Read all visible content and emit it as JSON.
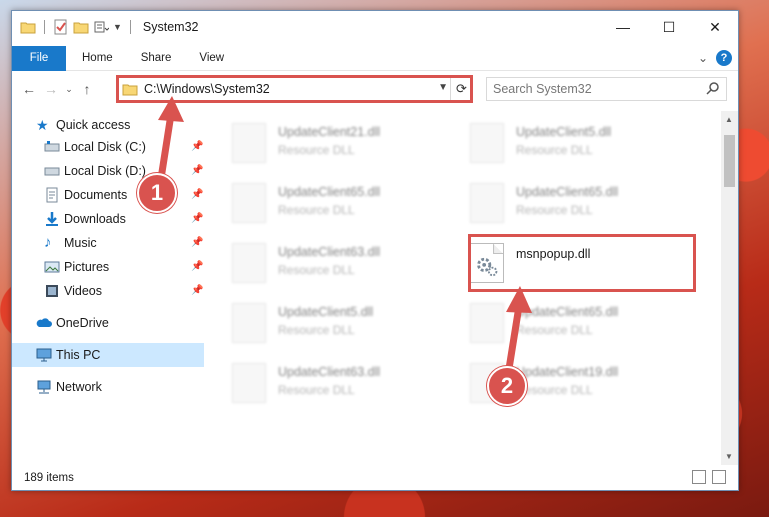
{
  "window": {
    "title": "System32"
  },
  "ribbon": {
    "file": "File",
    "tabs": [
      "Home",
      "Share",
      "View"
    ],
    "help": "?"
  },
  "nav": {
    "path": "C:\\Windows\\System32",
    "search_placeholder": "Search System32"
  },
  "sidebar": {
    "items": [
      {
        "label": "Quick access",
        "icon": "star-icon"
      },
      {
        "label": "Local Disk (C:)",
        "icon": "drive-icon",
        "pinned": true
      },
      {
        "label": "Local Disk (D:)",
        "icon": "drive-icon",
        "pinned": true
      },
      {
        "label": "Documents",
        "icon": "documents-icon",
        "pinned": true
      },
      {
        "label": "Downloads",
        "icon": "download-icon",
        "pinned": true
      },
      {
        "label": "Music",
        "icon": "music-icon",
        "pinned": true
      },
      {
        "label": "Pictures",
        "icon": "pictures-icon",
        "pinned": true
      },
      {
        "label": "Videos",
        "icon": "videos-icon",
        "pinned": true
      },
      {
        "label": "OneDrive",
        "icon": "cloud-icon"
      },
      {
        "label": "This PC",
        "icon": "computer-icon",
        "selected": true
      },
      {
        "label": "Network",
        "icon": "network-icon"
      }
    ]
  },
  "files": [
    {
      "name": "UpdateClient21.dll",
      "type": "Resource DLL"
    },
    {
      "name": "UpdateClient5.dll",
      "type": "Resource DLL"
    },
    {
      "name": "UpdateClient65.dll",
      "type": "Resource DLL"
    },
    {
      "name": "UpdateClient65.dll",
      "type": "Resource DLL"
    },
    {
      "name": "UpdateClient63.dll",
      "type": "Resource DLL"
    },
    {
      "name": "msnpopup.dll",
      "type": ""
    },
    {
      "name": "UpdateClient5.dll",
      "type": "Resource DLL"
    },
    {
      "name": "UpdateClient65.dll",
      "type": "Resource DLL"
    },
    {
      "name": "UpdateClient63.dll",
      "type": "Resource DLL"
    },
    {
      "name": "UpdateClient19.dll",
      "type": "Resource DLL"
    }
  ],
  "status": {
    "items": "189 items"
  },
  "markers": [
    "1",
    "2"
  ],
  "colors": {
    "accent": "#1979ca",
    "highlight": "#d9534f",
    "selection": "#cce8ff"
  }
}
